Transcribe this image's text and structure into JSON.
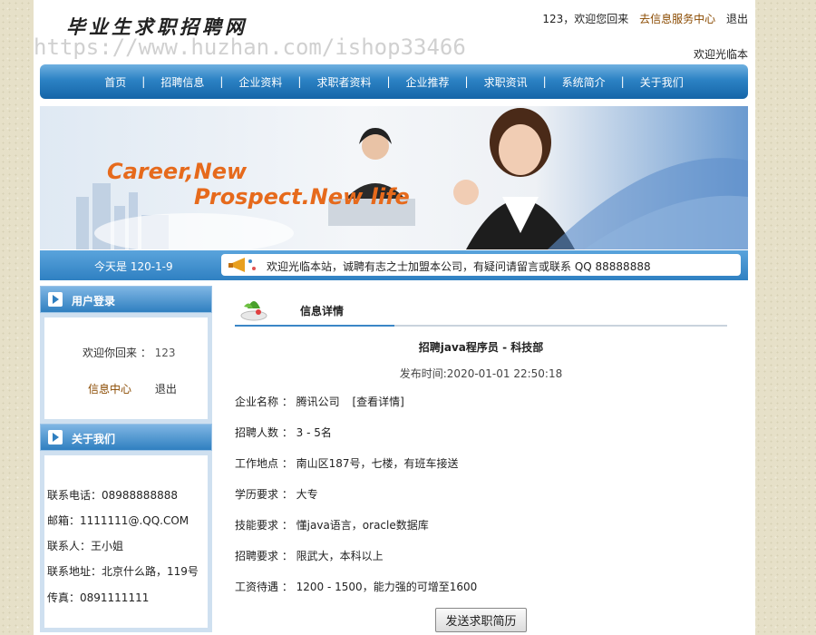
{
  "site": {
    "logo": "毕业生求职招聘网",
    "watermark": "https://www.huzhan.com/ishop33466"
  },
  "topbar": {
    "greeting": "123，欢迎您回来",
    "service_link": "去信息服务中心",
    "logout": "退出",
    "marquee": "欢迎光临本"
  },
  "nav": {
    "items": [
      "首页",
      "招聘信息",
      "企业资料",
      "求职者资料",
      "企业推荐",
      "求职资讯",
      "系统简介",
      "关于我们"
    ],
    "separator": "|"
  },
  "banner": {
    "tagline1": "Career,New",
    "tagline2": "Prospect.New life"
  },
  "notice": {
    "date": "今天是 120-1-9",
    "message": "欢迎光临本站，诚聘有志之士加盟本公司，有疑问请留言或联系 QQ 88888888"
  },
  "sidebar": {
    "login": {
      "title": "用户登录",
      "welcome": "欢迎你回来 ：",
      "username": "123",
      "info_center": "信息中心",
      "logout": "退出"
    },
    "about": {
      "title": "关于我们",
      "phone": "联系电话：08988888888",
      "email": "邮箱：1111111@.QQ.COM",
      "contact": "联系人：王小姐",
      "address": "联系地址：北京什么路，119号",
      "fax": "传真：0891111111"
    }
  },
  "content": {
    "section_title": "信息详情",
    "job_title": "招聘java程序员 - 科技部",
    "publish_time": "发布时间:2020-01-01 22:50:18",
    "fields": {
      "company_label": "企业名称 ：",
      "company_value": "腾讯公司",
      "company_link": "[查看详情]",
      "count_label": "招聘人数 ：",
      "count_value": "3 - 5名",
      "location_label": "工作地点 ：",
      "location_value": "南山区187号，七楼，有班车接送",
      "education_label": "学历要求 ：",
      "education_value": "大专",
      "skill_label": "技能要求 ：",
      "skill_value": "懂java语言，oracle数据库",
      "requirement_label": "招聘要求 ：",
      "requirement_value": "限武大，本科以上",
      "salary_label": "工资待遇 ：",
      "salary_value": "1200 - 1500，能力强的可增至1600"
    },
    "submit_button": "发送求职简历"
  }
}
